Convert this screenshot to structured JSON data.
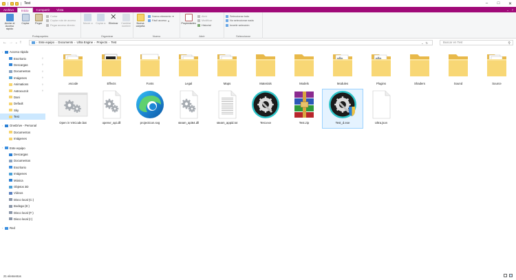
{
  "window": {
    "title": "Test"
  },
  "ribbon_tabs": [
    "Archivo",
    "Inicio",
    "Compartir",
    "Vista"
  ],
  "ribbon": {
    "portapapeles": {
      "label": "Portapapeles",
      "anclar": "Anclar al Acceso rápido",
      "copiar": "Copiar",
      "pegar": "Pegar",
      "cortar": "Cortar",
      "copiar_ruta": "Copiar ruta de acceso",
      "pegar_acceso": "Pegar acceso directo"
    },
    "organizar": {
      "label": "Organizar",
      "mover": "Mover a",
      "copiar_a": "Copiar a",
      "eliminar": "Eliminar",
      "cambiar_nombre": "Cambiar nombre"
    },
    "nuevo": {
      "label": "Nuevo",
      "nueva_carpeta": "Nueva carpeta",
      "nuevo_elemento": "Nuevo elemento",
      "facil_acceso": "Fácil acceso"
    },
    "abrir": {
      "label": "Abrir",
      "propiedades": "Propiedades",
      "abrir": "Abrir",
      "modificar": "Modificar",
      "historial": "Historial"
    },
    "seleccionar": {
      "label": "Seleccionar",
      "todo": "Seleccionar todo",
      "ninguno": "No seleccionar nada",
      "invertir": "Invertir selección"
    }
  },
  "address": {
    "crumbs": [
      "Este equipo",
      "Documents",
      "Ultra Engine",
      "Projects",
      "Test"
    ],
    "search_placeholder": "Buscar en Test"
  },
  "sidebar": {
    "items": [
      {
        "label": "Acceso rápido",
        "icon": "star-icon",
        "level": 0
      },
      {
        "label": "Escritorio",
        "icon": "desktop-icon",
        "level": 1,
        "pinned": true
      },
      {
        "label": "Descargas",
        "icon": "download-icon",
        "level": 1,
        "pinned": true
      },
      {
        "label": "Documentos",
        "icon": "document-icon",
        "level": 1,
        "pinned": true
      },
      {
        "label": "Imágenes",
        "icon": "image-icon",
        "level": 1,
        "pinned": true
      },
      {
        "label": "Animations",
        "icon": "folder-icon",
        "level": 1,
        "pinned": true
      },
      {
        "label": "Astrocuzcit",
        "icon": "folder-icon",
        "level": 1,
        "pinned": true
      },
      {
        "label": "Dani",
        "icon": "folder-icon",
        "level": 1
      },
      {
        "label": "Default",
        "icon": "folder-icon",
        "level": 1
      },
      {
        "label": "Sky",
        "icon": "folder-icon",
        "level": 1
      },
      {
        "label": "Test",
        "icon": "folder-icon",
        "level": 1,
        "selected": true
      },
      {
        "label": "",
        "icon": "",
        "level": 0,
        "spacer": true
      },
      {
        "label": "OneDrive - Personal",
        "icon": "cloud-icon",
        "level": 0
      },
      {
        "label": "Documentos",
        "icon": "folder-icon",
        "level": 1
      },
      {
        "label": "Imágenes",
        "icon": "folder-icon",
        "level": 1
      },
      {
        "label": "",
        "icon": "",
        "level": 0,
        "spacer": true
      },
      {
        "label": "Este equipo",
        "icon": "computer-icon",
        "level": 0
      },
      {
        "label": "Descargas",
        "icon": "download-icon",
        "level": 1
      },
      {
        "label": "Documentos",
        "icon": "document-icon",
        "level": 1
      },
      {
        "label": "Escritorio",
        "icon": "desktop-icon",
        "level": 1
      },
      {
        "label": "Imágenes",
        "icon": "image-icon",
        "level": 1
      },
      {
        "label": "Música",
        "icon": "music-icon",
        "level": 1
      },
      {
        "label": "Objetos 3D",
        "icon": "cube-icon",
        "level": 1
      },
      {
        "label": "Vídeos",
        "icon": "video-icon",
        "level": 1
      },
      {
        "label": "Disco local (C:)",
        "icon": "drive-icon",
        "level": 1
      },
      {
        "label": "Bodega (E:)",
        "icon": "drive-icon",
        "level": 1
      },
      {
        "label": "Disco local (F:)",
        "icon": "drive-icon",
        "level": 1
      },
      {
        "label": "Disco local (I:)",
        "icon": "drive-icon",
        "level": 1
      },
      {
        "label": "",
        "icon": "",
        "level": 0,
        "spacer": true
      },
      {
        "label": "Red",
        "icon": "network-icon",
        "level": 0
      }
    ]
  },
  "files": [
    {
      "name": ".vscode",
      "type": "folder-docs"
    },
    {
      "name": "Effects",
      "type": "folder-effects"
    },
    {
      "name": "Fonts",
      "type": "folder-fonts"
    },
    {
      "name": "Legal",
      "type": "folder-docs"
    },
    {
      "name": "Maps",
      "type": "folder-docs"
    },
    {
      "name": "Materials",
      "type": "folder"
    },
    {
      "name": "Models",
      "type": "folder"
    },
    {
      "name": "Modules",
      "type": "folder-gear"
    },
    {
      "name": "Plugins",
      "type": "folder-gear"
    },
    {
      "name": "Shaders",
      "type": "folder"
    },
    {
      "name": "Sound",
      "type": "folder"
    },
    {
      "name": "Source",
      "type": "folder-source"
    },
    {
      "name": "Open in VSCode.bat",
      "type": "gears"
    },
    {
      "name": "openvr_api.dll",
      "type": "gears-page"
    },
    {
      "name": "projecticon.svg",
      "type": "edge"
    },
    {
      "name": "steam_api64.dll",
      "type": "gears-page"
    },
    {
      "name": "steam_appid.txt",
      "type": "text"
    },
    {
      "name": "Test.exe",
      "type": "ultra"
    },
    {
      "name": "Test.zip",
      "type": "winrar"
    },
    {
      "name": "Test_d.exe",
      "type": "ultra-shield",
      "selected": true
    },
    {
      "name": "Ultra.json",
      "type": "blank"
    }
  ],
  "status": {
    "count": "21 elementos"
  },
  "colors": {
    "accent": "#a00a78",
    "folder": "#f6d36b",
    "selection": "#cce8ff"
  }
}
